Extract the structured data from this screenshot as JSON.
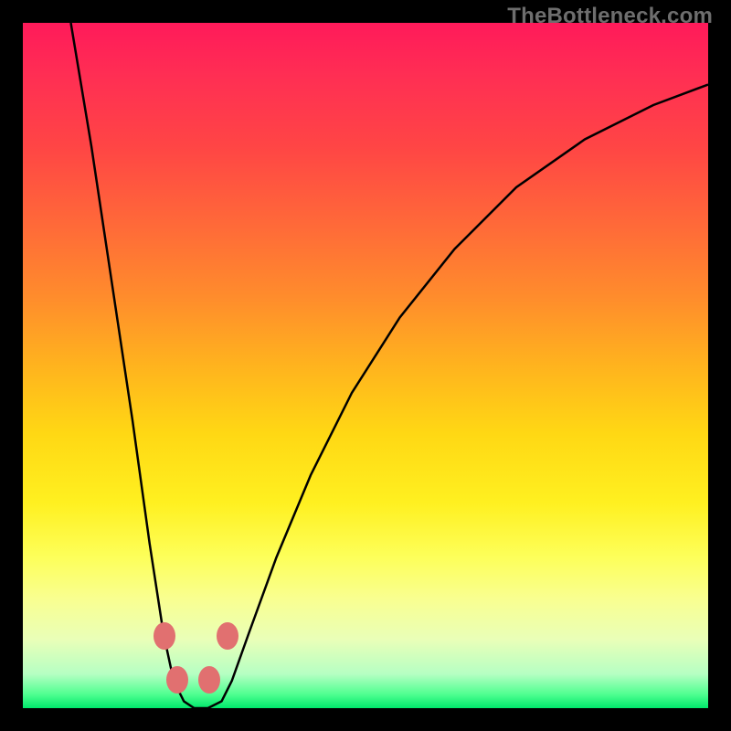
{
  "watermark": "TheBottleneck.com",
  "chart_data": {
    "type": "line",
    "title": "",
    "xlabel": "",
    "ylabel": "",
    "xlim": [
      0,
      1
    ],
    "ylim": [
      0,
      1
    ],
    "grid": false,
    "legend": false,
    "series": [
      {
        "name": "curve",
        "points": [
          [
            0.07,
            1.0
          ],
          [
            0.1,
            0.82
          ],
          [
            0.13,
            0.62
          ],
          [
            0.16,
            0.42
          ],
          [
            0.185,
            0.24
          ],
          [
            0.205,
            0.11
          ],
          [
            0.22,
            0.04
          ],
          [
            0.235,
            0.01
          ],
          [
            0.25,
            0.0
          ],
          [
            0.27,
            0.0
          ],
          [
            0.29,
            0.01
          ],
          [
            0.305,
            0.04
          ],
          [
            0.33,
            0.11
          ],
          [
            0.37,
            0.22
          ],
          [
            0.42,
            0.34
          ],
          [
            0.48,
            0.46
          ],
          [
            0.55,
            0.57
          ],
          [
            0.63,
            0.67
          ],
          [
            0.72,
            0.76
          ],
          [
            0.82,
            0.83
          ],
          [
            0.92,
            0.88
          ],
          [
            1.0,
            0.91
          ]
        ]
      }
    ],
    "markers": [
      {
        "x": 0.207,
        "y": 0.105
      },
      {
        "x": 0.225,
        "y": 0.042
      },
      {
        "x": 0.272,
        "y": 0.042
      },
      {
        "x": 0.298,
        "y": 0.105
      }
    ],
    "background_gradient": {
      "top": "#ff1a5a",
      "mid_upper": "#ff8c2c",
      "mid": "#ffd814",
      "mid_lower": "#f9ff90",
      "bottom": "#00e86b"
    }
  }
}
